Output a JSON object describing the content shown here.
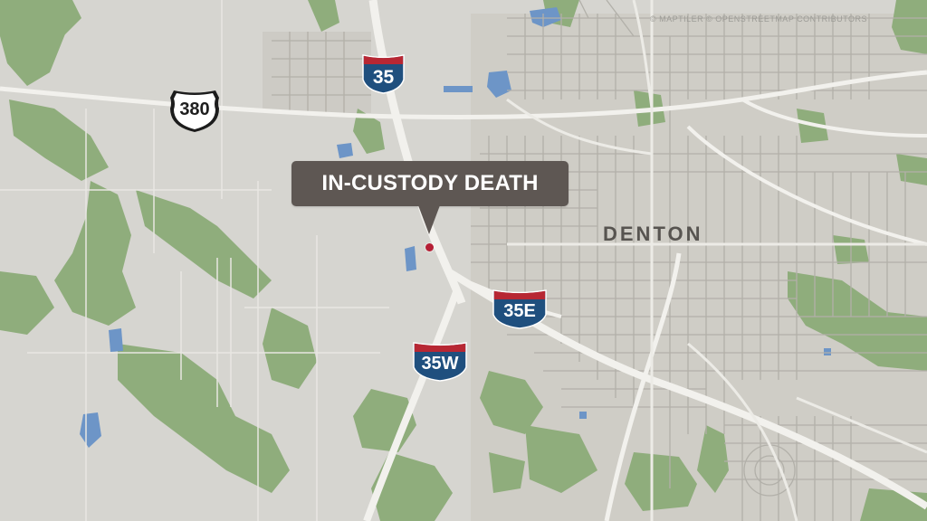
{
  "map": {
    "attribution": "© MAPTILER © OPENSTREETMAP CONTRIBUTORS",
    "callout": {
      "label": "IN-CUSTODY DEATH"
    },
    "city": {
      "name": "DENTON"
    },
    "shields": {
      "i35": "35",
      "i35e": "35E",
      "i35w": "35W",
      "us380": "380"
    },
    "colors": {
      "background": "#d6d5d0",
      "parks": "#8fad7c",
      "water": "#6d95c7",
      "highway": "#f2f1ed",
      "streets": "#b2b0a9",
      "interstate_blue": "#1f4f7e",
      "interstate_red": "#b72733",
      "callout": "#5e5753",
      "marker": "#b51f35"
    }
  }
}
